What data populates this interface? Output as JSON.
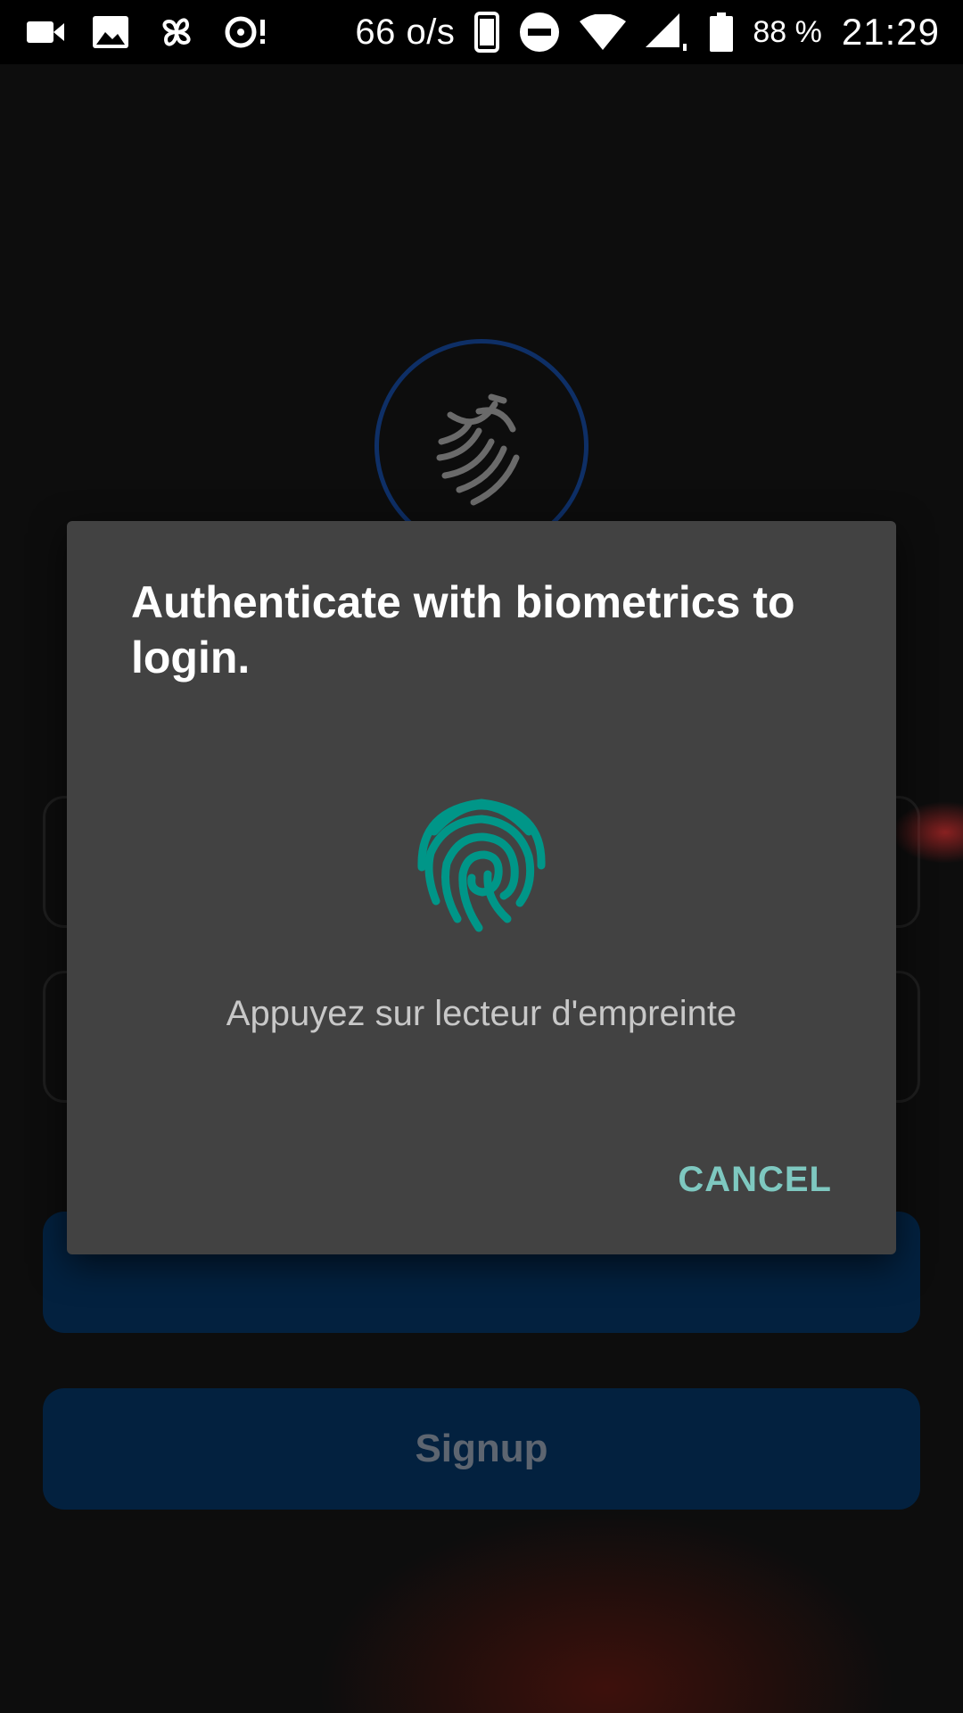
{
  "status_bar": {
    "network_speed": "66 o/s",
    "battery_percent": "88 %",
    "time": "21:29",
    "icons": [
      "video-icon",
      "image-icon",
      "pinwheel-icon",
      "sync-alert-icon",
      "phone-icon",
      "do-not-disturb-icon",
      "wifi-icon",
      "signal-icon",
      "battery-icon"
    ]
  },
  "background_app": {
    "signup_label": "Signup"
  },
  "dialog": {
    "title": "Authenticate with biometrics to login.",
    "message": "Appuyez sur lecteur d'empreinte",
    "cancel_label": "CANCEL",
    "accent_color": "#009688"
  }
}
